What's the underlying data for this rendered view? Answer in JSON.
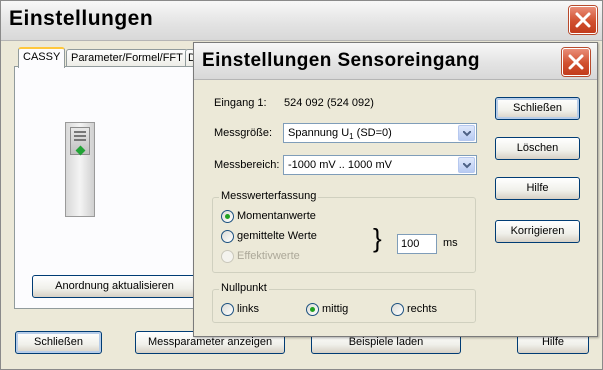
{
  "main": {
    "title": "Einstellungen",
    "tabs": [
      "CASSY",
      "Parameter/Formel/FFT",
      "D"
    ],
    "update_arrangement_label": "Anordnung aktualisieren",
    "bottom_buttons": {
      "close": "Schließen",
      "show_params": "Messparameter anzeigen",
      "examples": "Beispiele laden",
      "help": "Hilfe"
    }
  },
  "dialog": {
    "title": "Einstellungen Sensoreingang",
    "input_label": "Eingang 1:",
    "input_value": "524 092 (524 092)",
    "quantity_label": "Messgröße:",
    "quantity_value_pre": "Spannung U",
    "quantity_value_sub": "1",
    "quantity_value_post": " (SD=0)",
    "range_label": "Messbereich:",
    "range_value": "-1000 mV .. 1000 mV",
    "acquisition": {
      "legend": "Messwerterfassung",
      "options": [
        "Momentanwerte",
        "gemittelte Werte",
        "Effektivwerte"
      ],
      "selected": "Momentanwerte",
      "brace": "}",
      "time_value": "100",
      "time_unit": "ms"
    },
    "zero_point": {
      "legend": "Nullpunkt",
      "options": [
        "links",
        "mittig",
        "rechts"
      ],
      "selected": "mittig"
    },
    "buttons": {
      "close": "Schließen",
      "delete": "Löschen",
      "help": "Hilfe",
      "correct": "Korrigieren"
    }
  },
  "colors": {
    "window_bg": "#ece9d8",
    "close_red": "#d1502f",
    "radio_green": "#21a121",
    "button_border": "#003c74"
  },
  "icons": {
    "close": "close-icon",
    "dropdown": "chevron-down-icon",
    "sensor": "sensor-device-icon"
  }
}
